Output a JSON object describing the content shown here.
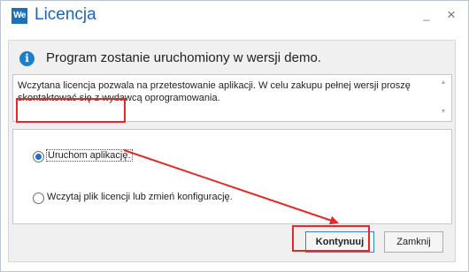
{
  "window": {
    "title": "Licencja",
    "app_icon_text": "We",
    "minimize_glyph": "_",
    "close_glyph": "×"
  },
  "info": {
    "icon_glyph": "i",
    "heading": "Program zostanie uruchomiony w wersji demo."
  },
  "message": {
    "text": "Wczytana licencja pozwala na przetestowanie aplikacji. W celu zakupu pełnej wersji proszę skontaktować się z wydawcą oprogramowania.",
    "scroll_up": "▲",
    "scroll_down": "▼"
  },
  "options": [
    {
      "label": "Uruchom aplikację.",
      "selected": true
    },
    {
      "label": "Wczytaj plik licencji lub zmień konfigurację.",
      "selected": false
    }
  ],
  "buttons": {
    "continue_label": "Kontynuuj",
    "close_label": "Zamknij"
  },
  "colors": {
    "title_blue": "#1e64b4",
    "highlight_red": "#e12b2b",
    "radio_fill": "#1f6ec8"
  }
}
